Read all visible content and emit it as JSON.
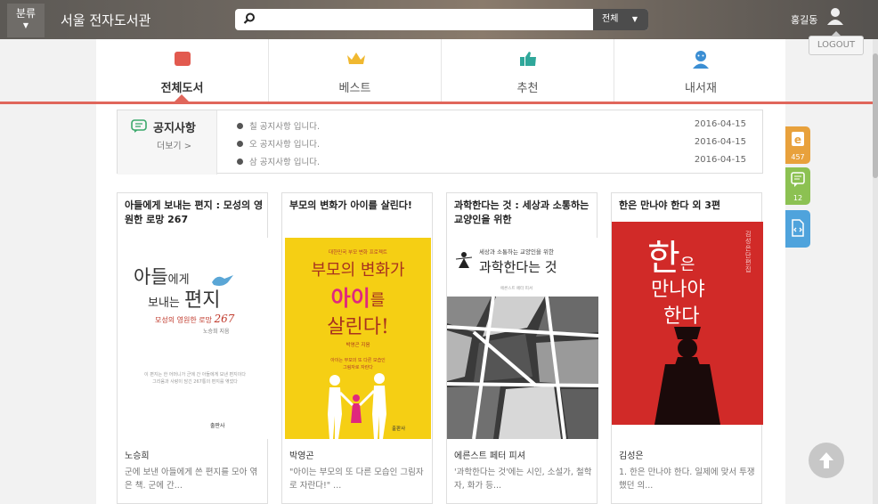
{
  "header": {
    "category_label": "분류",
    "app_title": "서울 전자도서관",
    "search_value": "",
    "search_scope": "전체",
    "user_name": "홍길동",
    "logout_label": "LOGOUT"
  },
  "tabs": [
    {
      "label": "전체도서",
      "icon": "book-icon",
      "active": true
    },
    {
      "label": "베스트",
      "icon": "crown-icon",
      "active": false
    },
    {
      "label": "추천",
      "icon": "thumbs-up-icon",
      "active": false
    },
    {
      "label": "내서재",
      "icon": "user-icon",
      "active": false
    }
  ],
  "notice": {
    "title": "공지사항",
    "more_label": "더보기 >",
    "items": [
      {
        "text": "칠 공지사항 입니다.",
        "date": "2016-04-15"
      },
      {
        "text": "오 공지사항 입니다.",
        "date": "2016-04-15"
      },
      {
        "text": "삼 공지사항 입니다.",
        "date": "2016-04-15"
      }
    ]
  },
  "books": [
    {
      "title": "아들에게 보내는 편지 : 모성의 영원한 로망 267",
      "author": "노승희",
      "desc": "군에 보낸 아들에게 쓴 편지를 모아 엮은 책. 군에 간...",
      "cover": {
        "line1a": "아들",
        "line1b": "에게",
        "line2a": "보내는",
        "line2b": "편지",
        "subtitle": "모성의 영원한 로망",
        "number": "267",
        "byline": "노승희 지음",
        "body1": "이 편지는 한 어머니가 군에 간 아들에게 보낸 편지이다",
        "body2": "그리움과 사랑이 담긴 267통의 편지를 엮었다",
        "publisher": "출판사"
      }
    },
    {
      "title": "부모의 변화가 아이를 살린다!",
      "author": "박영곤",
      "desc": "\"아이는 부모의 또 다른 모습인 그림자로 자란다!\" ...",
      "cover": {
        "tagline": "대한민국 부모 변화 프로젝트",
        "line1": "부모의 변화가",
        "line2a": "아이",
        "line2b": "를",
        "line3": "살린다!",
        "byline": "박영곤 지음",
        "body1": "아이는 부모의 또 다른 모습인",
        "body2": "그림자로 자란다",
        "publisher": "출판사"
      }
    },
    {
      "title": "과학한다는 것 : 세상과 소통하는 교양인을 위한",
      "author": "에른스트 페터 피셔",
      "desc": "'과학한다는 것'에는 시인, 소설가, 철학자, 화가 등...",
      "cover": {
        "subtitle": "세상과 소통하는 교양인을 위한",
        "title": "과학한다는 것",
        "byline": "에른스트 페터 피셔"
      }
    },
    {
      "title": "한은 만나야 한다 외 3편",
      "author": "김성은",
      "desc": "1. 한은 만나야 한다. 일제에 맞서 투쟁했던 의...",
      "cover": {
        "big": "한",
        "small": "은",
        "line2": "만나야",
        "line3": "한다",
        "side": "김성은 단편집"
      }
    }
  ],
  "side_buttons": [
    {
      "icon": "ebook-icon",
      "count": "457",
      "color": "#e8a13c"
    },
    {
      "icon": "comment-icon",
      "count": "12",
      "color": "#8cc152"
    },
    {
      "icon": "document-code-icon",
      "count": "",
      "color": "#4fa3dc"
    }
  ],
  "colors": {
    "accent": "#e0665b",
    "header": "#6e6760"
  }
}
